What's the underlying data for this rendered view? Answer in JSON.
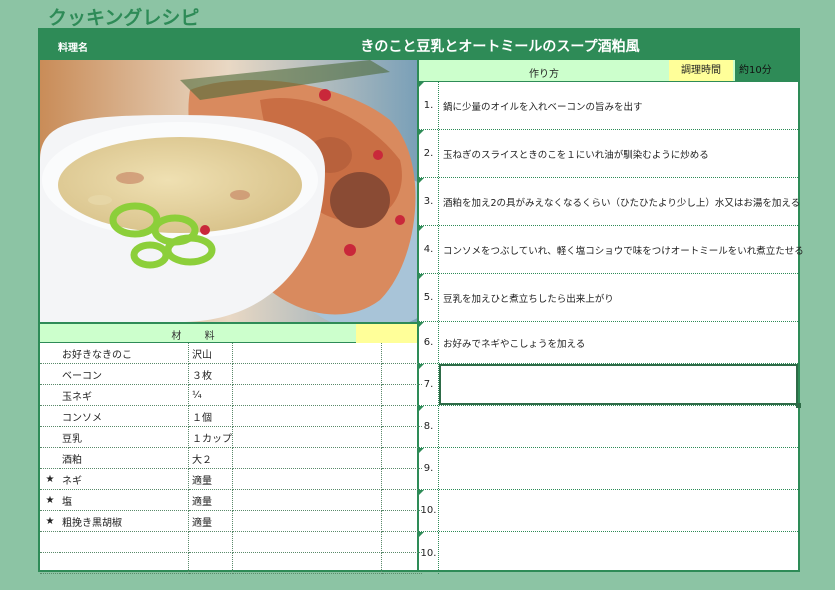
{
  "app": {
    "title": "クッキングレシピ"
  },
  "recipe": {
    "name_label": "料理名",
    "name": "きのこと豆乳とオートミールのスープ酒粕風"
  },
  "ingredients": {
    "header": "材 料",
    "rows": [
      {
        "star": "",
        "name": "お好きなきのこ",
        "qty": "沢山"
      },
      {
        "star": "",
        "name": "ベーコン",
        "qty": "３枚"
      },
      {
        "star": "",
        "name": "玉ネギ",
        "qty": "¼"
      },
      {
        "star": "",
        "name": "コンソメ",
        "qty": "１個"
      },
      {
        "star": "",
        "name": "豆乳",
        "qty": "１カップ"
      },
      {
        "star": "",
        "name": "酒粕",
        "qty": "大２"
      },
      {
        "star": "★",
        "name": "ネギ",
        "qty": "適量"
      },
      {
        "star": "★",
        "name": "塩",
        "qty": "適量"
      },
      {
        "star": "★",
        "name": "粗挽き黒胡椒",
        "qty": "適量"
      },
      {
        "star": "",
        "name": "",
        "qty": ""
      },
      {
        "star": "",
        "name": "",
        "qty": ""
      }
    ]
  },
  "method": {
    "header": "作り方",
    "time_label": "調理時間",
    "time_value": "約10分",
    "steps": [
      {
        "num": "1.",
        "text": "鍋に少量のオイルを入れベーコンの旨みを出す"
      },
      {
        "num": "2.",
        "text": "玉ねぎのスライスときのこを１にいれ油が馴染むように炒める"
      },
      {
        "num": "3.",
        "text": "酒粕を加え2の具がみえなくなるくらい（ひたひたより少し上）水又はお湯を加える"
      },
      {
        "num": "4.",
        "text": "コンソメをつぶしていれ、軽く塩コショウで味をつけオートミールをいれ煮立たせる"
      },
      {
        "num": "5.",
        "text": "豆乳を加えひと煮立ちしたら出来上がり"
      },
      {
        "num": "6.",
        "text": "お好みでネギやこしょうを加える"
      },
      {
        "num": "7.",
        "text": ""
      },
      {
        "num": "8.",
        "text": ""
      },
      {
        "num": "9.",
        "text": ""
      },
      {
        "num": "10.",
        "text": ""
      },
      {
        "num": "10.",
        "text": ""
      }
    ]
  },
  "colors": {
    "accent": "#2e8b57",
    "light_green": "#ccffcc",
    "yellow": "#ffff99",
    "background": "#8cc4a4"
  }
}
